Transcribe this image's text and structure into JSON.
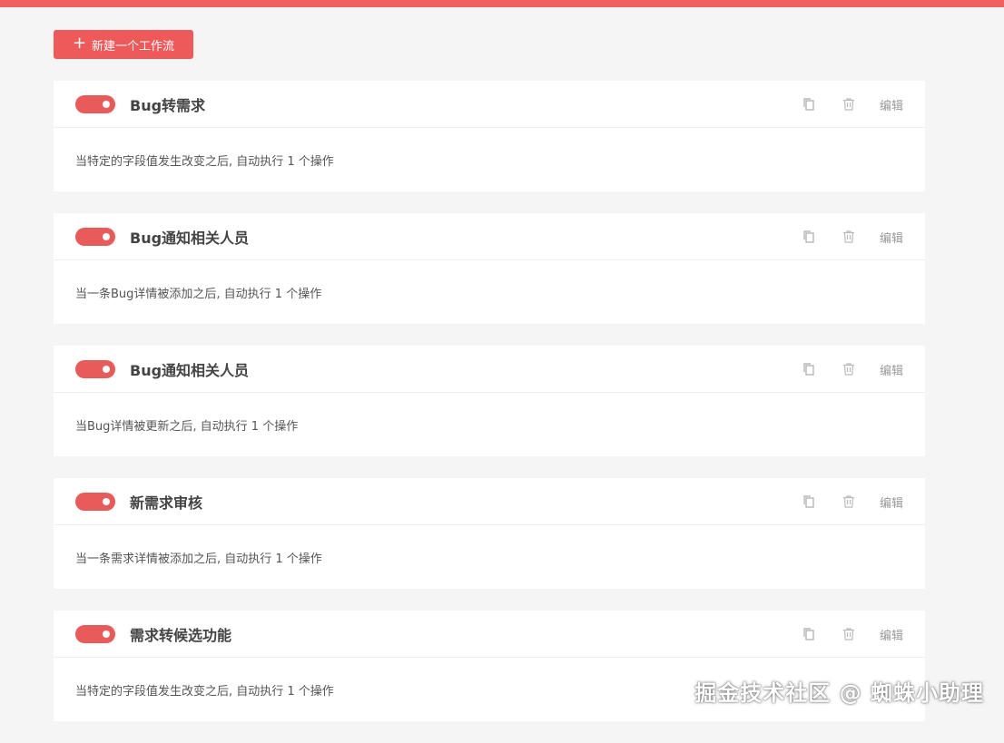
{
  "toolbar": {
    "new_workflow_label": "新建一个工作流"
  },
  "workflows": [
    {
      "title": "Bug转需求",
      "description": "当特定的字段值发生改变之后, 自动执行 1 个操作",
      "enabled": true,
      "edit_label": "编辑"
    },
    {
      "title": "Bug通知相关人员",
      "description": "当一条Bug详情被添加之后, 自动执行 1 个操作",
      "enabled": true,
      "edit_label": "编辑"
    },
    {
      "title": "Bug通知相关人员",
      "description": "当Bug详情被更新之后, 自动执行 1 个操作",
      "enabled": true,
      "edit_label": "编辑"
    },
    {
      "title": "新需求审核",
      "description": "当一条需求详情被添加之后, 自动执行 1 个操作",
      "enabled": true,
      "edit_label": "编辑"
    },
    {
      "title": "需求转候选功能",
      "description": "当特定的字段值发生改变之后, 自动执行 1 个操作",
      "enabled": true,
      "edit_label": "编辑"
    }
  ],
  "watermark": "掘金技术社区 @ 蜘蛛小助理",
  "colors": {
    "accent": "#ee5a5a",
    "top_bar": "#f06060",
    "background": "#f5f5f5"
  },
  "icons": {
    "copy": "copy-icon",
    "delete": "trash-icon",
    "add": "plus-icon"
  }
}
